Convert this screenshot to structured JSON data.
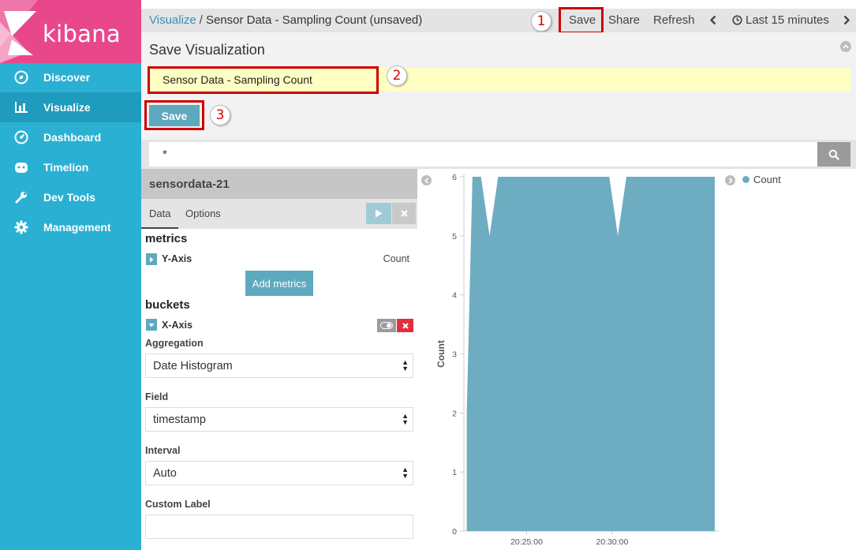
{
  "app": {
    "name": "kibana"
  },
  "sidebar": {
    "items": [
      {
        "label": "Discover",
        "icon": "compass-icon"
      },
      {
        "label": "Visualize",
        "icon": "bar-chart-icon"
      },
      {
        "label": "Dashboard",
        "icon": "dashboard-icon"
      },
      {
        "label": "Timelion",
        "icon": "timelion-icon"
      },
      {
        "label": "Dev Tools",
        "icon": "wrench-icon"
      },
      {
        "label": "Management",
        "icon": "gear-icon"
      }
    ]
  },
  "topbar": {
    "breadcrumb_root": "Visualize",
    "breadcrumb_sep": "/",
    "breadcrumb_current": "Sensor Data - Sampling Count (unsaved)",
    "save": "Save",
    "share": "Share",
    "refresh": "Refresh",
    "time_range": "Last 15 minutes"
  },
  "annotations": {
    "one": "1",
    "two": "2",
    "three": "3"
  },
  "save_panel": {
    "title": "Save Visualization",
    "name_value": "Sensor Data - Sampling Count",
    "save_button": "Save"
  },
  "query": {
    "value": "*"
  },
  "editor": {
    "index_pattern": "sensordata-21",
    "tabs": [
      "Data",
      "Options"
    ],
    "metrics_heading": "metrics",
    "y_axis_label": "Y-Axis",
    "y_axis_agg": "Count",
    "add_metrics": "Add metrics",
    "buckets_heading": "buckets",
    "x_axis_label": "X-Axis",
    "aggregation_label": "Aggregation",
    "aggregation_value": "Date Histogram",
    "field_label": "Field",
    "field_value": "timestamp",
    "interval_label": "Interval",
    "interval_value": "Auto",
    "custom_label": "Custom Label"
  },
  "colors": {
    "brand": "#e8488b",
    "sidebar": "#2ab0d3",
    "series": "#6eadc1",
    "highlight": "#cc0000"
  },
  "chart_data": {
    "type": "area",
    "ylabel": "Count",
    "yticks": [
      0,
      1,
      2,
      3,
      4,
      5,
      6
    ],
    "ylim": [
      0,
      6
    ],
    "xticks": [
      "20:25:00",
      "20:30:00"
    ],
    "legend": [
      "Count"
    ],
    "legend_position": "top-right",
    "series": [
      {
        "name": "Count",
        "x": [
          "20:21:30",
          "20:21:50",
          "20:22:20",
          "20:22:50",
          "20:23:20",
          "20:29:50",
          "20:30:20",
          "20:30:50",
          "20:36:00",
          "20:36:00"
        ],
        "values": [
          2,
          6,
          6,
          5,
          6,
          6,
          5,
          6,
          6,
          3
        ]
      }
    ]
  }
}
